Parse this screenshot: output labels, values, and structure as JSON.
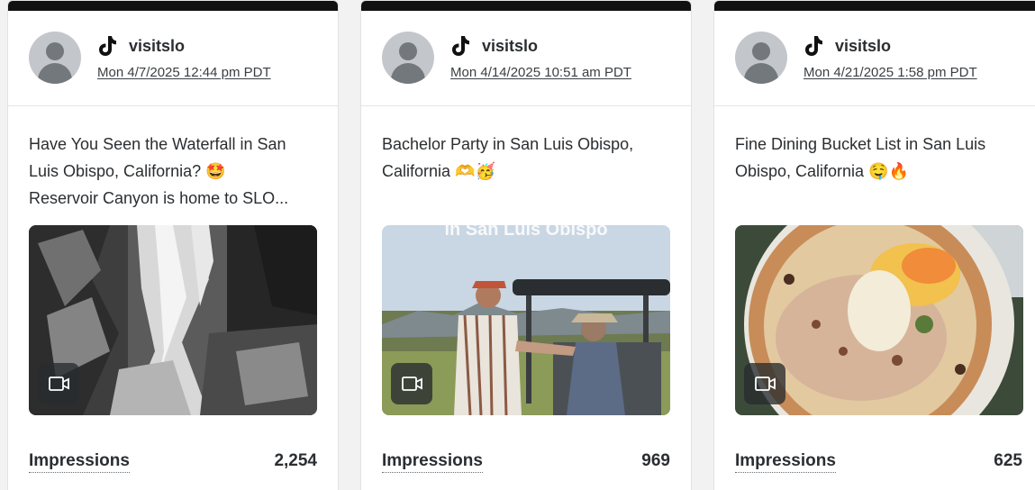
{
  "posts": [
    {
      "account": "visitslo",
      "platform_icon": "tiktok-icon",
      "date": "Mon 4/7/2025 12:44 pm PDT",
      "caption_line1": "Have You Seen the Waterfall in San",
      "caption_line2": "Luis Obispo, California? 🤩",
      "caption_line3": "Reservoir Canyon is home to SLO...",
      "media_type": "video",
      "metric_label": "Impressions",
      "metric_value": "2,254"
    },
    {
      "account": "visitslo",
      "platform_icon": "tiktok-icon",
      "date": "Mon 4/14/2025 10:51 am PDT",
      "caption_line1": "Bachelor Party in San Luis Obispo,",
      "caption_line2": "California 🫶🥳",
      "caption_line3": "",
      "thumb_overlay_text": "in San Luis Obispo",
      "media_type": "video",
      "metric_label": "Impressions",
      "metric_value": "969"
    },
    {
      "account": "visitslo",
      "platform_icon": "tiktok-icon",
      "date": "Mon 4/21/2025 1:58 pm PDT",
      "caption_line1": "Fine Dining Bucket List in San Luis",
      "caption_line2": "Obispo, California 🤤🔥",
      "caption_line3": "",
      "media_type": "video",
      "metric_label": "Impressions",
      "metric_value": "625"
    }
  ]
}
